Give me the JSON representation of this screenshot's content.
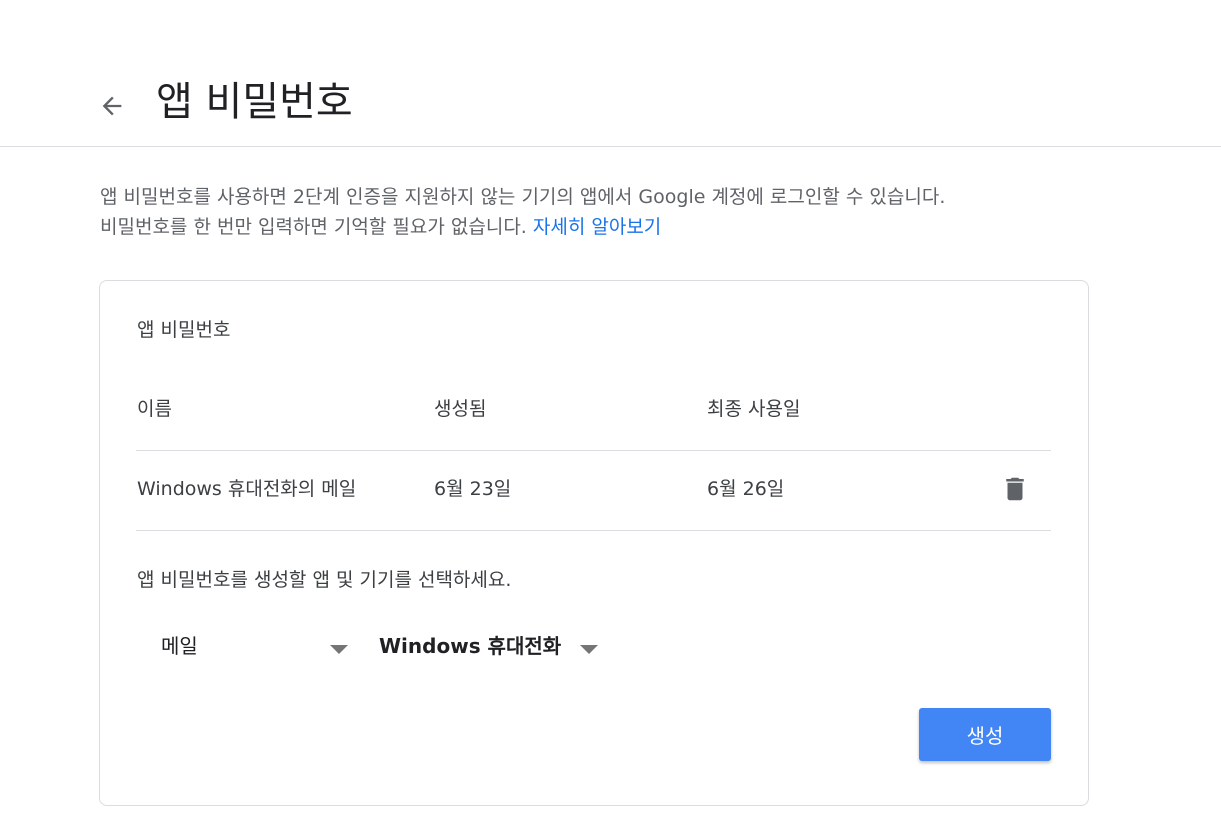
{
  "header": {
    "title": "앱 비밀번호",
    "back_icon": "arrow-back-icon"
  },
  "intro": {
    "text_line1": "앱 비밀번호를 사용하면 2단계 인증을 지원하지 않는 기기의 앱에서 Google 계정에 로그인할 수 있습니다.",
    "text_line2": "비밀번호를 한 번만 입력하면 기억할 필요가 없습니다.",
    "learn_more": "자세히 알아보기",
    "link_color": "#1a73e8"
  },
  "card": {
    "title": "앱 비밀번호",
    "columns": [
      "이름",
      "생성됨",
      "최종 사용일"
    ],
    "rows": [
      {
        "name": "Windows 휴대전화의 메일",
        "created": "6월 23일",
        "last_used": "6월 26일",
        "delete_icon": "trash-icon"
      }
    ],
    "select_label": "앱 비밀번호를 생성할 앱 및 기기를 선택하세요.",
    "app_select": {
      "value": "메일",
      "icon": "dropdown-arrow-icon"
    },
    "device_select": {
      "value": "Windows 휴대전화",
      "icon": "dropdown-arrow-icon"
    },
    "generate_button": "생성",
    "button_color": "#4285f4"
  }
}
